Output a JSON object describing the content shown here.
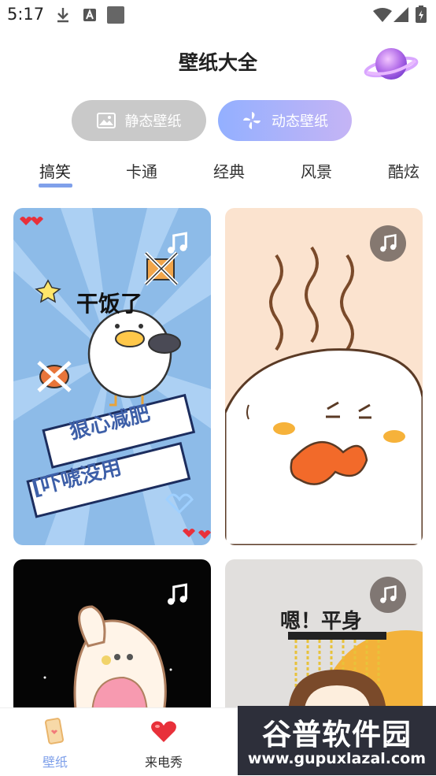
{
  "status_bar": {
    "time": "5:17"
  },
  "header": {
    "title": "壁纸大全"
  },
  "segments": {
    "static_label": "静态壁纸",
    "dynamic_label": "动态壁纸",
    "active": "dynamic"
  },
  "tabs": [
    {
      "label": "搞笑",
      "active": true
    },
    {
      "label": "卡通",
      "active": false
    },
    {
      "label": "经典",
      "active": false
    },
    {
      "label": "风景",
      "active": false
    },
    {
      "label": "酷炫",
      "active": false
    }
  ],
  "cards": [
    {
      "lines": [
        "干饭了",
        "狠心减肥",
        "[吓唬没用"
      ],
      "has_music": true
    },
    {
      "has_music": true
    },
    {
      "has_music": true
    },
    {
      "lines": [
        "嗯！平身"
      ],
      "has_music": true
    }
  ],
  "bottom_nav": [
    {
      "label": "壁纸",
      "active": true,
      "icon": "phone-wallpaper-icon"
    },
    {
      "label": "来电秀",
      "active": false,
      "icon": "heart-icon"
    }
  ],
  "watermark": {
    "title": "谷普软件园",
    "url": "www.gupuxlazal.com"
  },
  "colors": {
    "accent": "#7fa0ea",
    "segment_inactive": "#c9c9c9",
    "heart": "#e8303a"
  }
}
